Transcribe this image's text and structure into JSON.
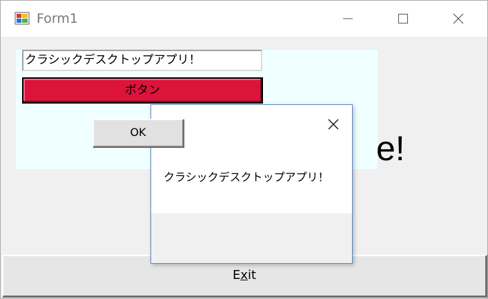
{
  "window": {
    "title": "Form1",
    "icons": {
      "app": "form-app-icon",
      "minimize": "minimize-icon",
      "maximize": "maximize-icon",
      "close": "close-icon"
    }
  },
  "form": {
    "textbox_value": "クラシックデスクトップアプリ！",
    "button_label": "ボタン",
    "button_color": "#dc143c",
    "panel_color": "#f0ffff",
    "partial_text": "e!",
    "exit_label_prefix": "E",
    "exit_label_accel": "x",
    "exit_label_suffix": "it"
  },
  "message_box": {
    "message": "クラシックデスクトップアプリ！",
    "ok_label": "OK",
    "close_icon": "close-icon"
  }
}
